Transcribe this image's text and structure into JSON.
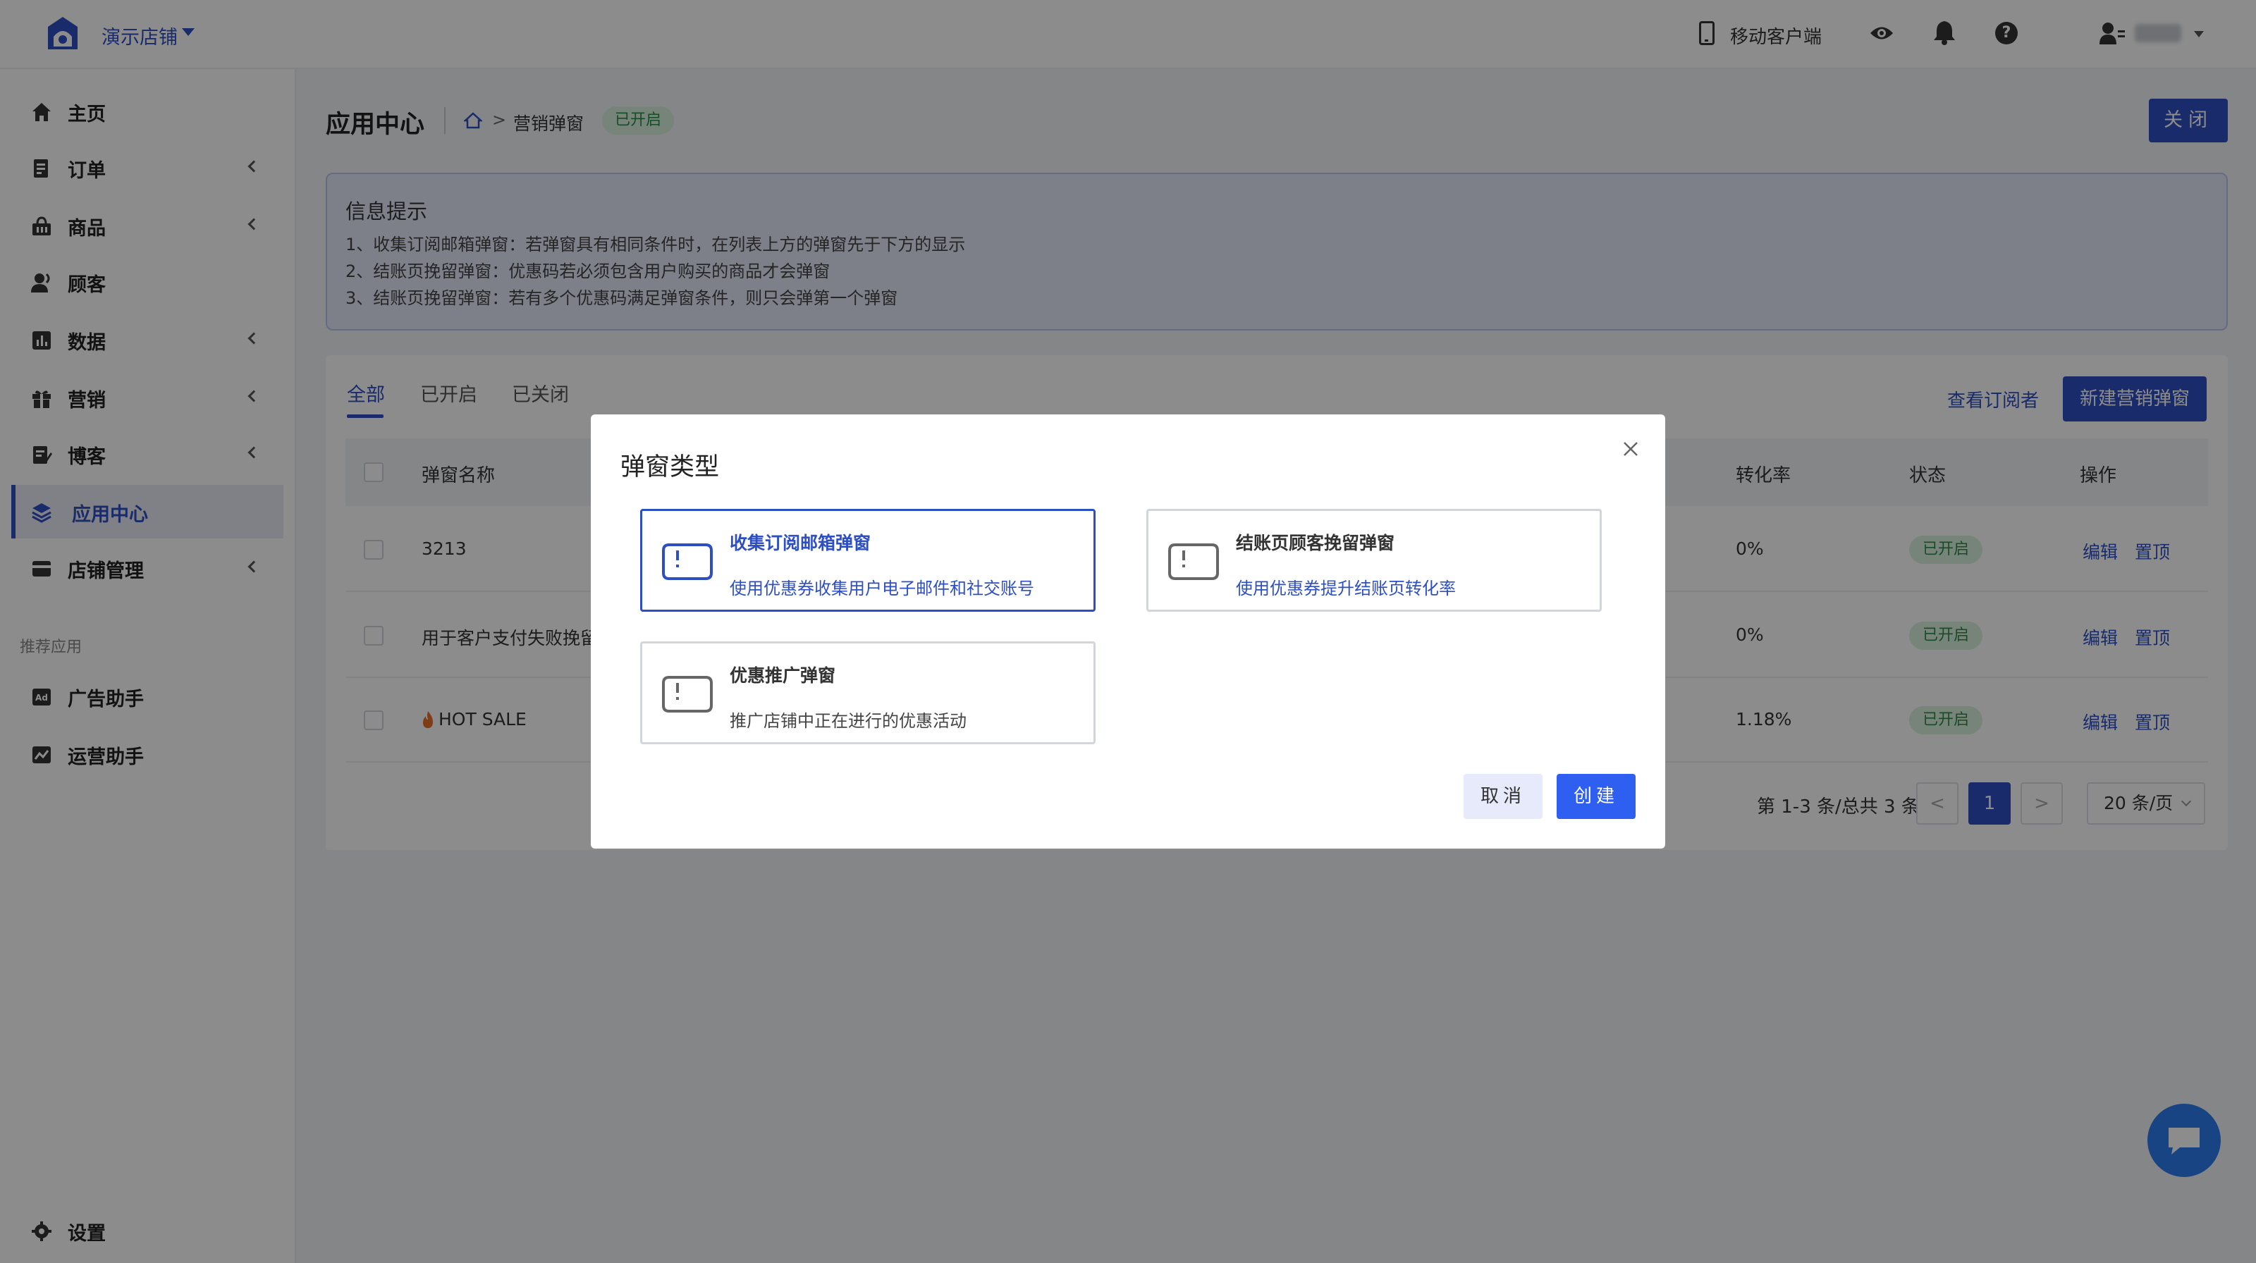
{
  "header": {
    "store_name": "演示店铺",
    "mobile_label": "移动客户端"
  },
  "sidebar": {
    "items": [
      {
        "label": "主页",
        "icon": "home-icon"
      },
      {
        "label": "订单",
        "icon": "order-icon"
      },
      {
        "label": "商品",
        "icon": "basket-icon"
      },
      {
        "label": "顾客",
        "icon": "customer-icon"
      },
      {
        "label": "数据",
        "icon": "chart-icon"
      },
      {
        "label": "营销",
        "icon": "gift-icon"
      },
      {
        "label": "博客",
        "icon": "blog-icon"
      },
      {
        "label": "应用中心",
        "icon": "layers-icon"
      },
      {
        "label": "店铺管理",
        "icon": "store-icon"
      }
    ],
    "section_label": "推荐应用",
    "apps": [
      {
        "label": "广告助手",
        "icon": "ad-icon"
      },
      {
        "label": "运营助手",
        "icon": "ops-icon"
      }
    ],
    "settings_label": "设置"
  },
  "page": {
    "title": "应用中心",
    "breadcrumb_sep": ">",
    "breadcrumb_current": "营销弹窗",
    "breadcrumb_badge": "已开启",
    "close_label": "关闭"
  },
  "info": {
    "title": "信息提示",
    "lines": [
      "1、收集订阅邮箱弹窗：若弹窗具有相同条件时，在列表上方的弹窗先于下方的显示",
      "2、结账页挽留弹窗：优惠码若必须包含用户购买的商品才会弹窗",
      "3、结账页挽留弹窗：若有多个优惠码满足弹窗条件，则只会弹第一个弹窗"
    ]
  },
  "tabs": [
    "全部",
    "已开启",
    "已关闭"
  ],
  "actions": {
    "view_subscribers": "查看订阅者",
    "new_popup": "新建营销弹窗"
  },
  "table": {
    "headers": [
      "弹窗名称",
      "转化率",
      "状态",
      "操作"
    ],
    "rows": [
      {
        "name": "3213",
        "rate": "0%",
        "status": "已开启",
        "edit": "编辑",
        "pin": "置顶"
      },
      {
        "name": "用于客户支付失败挽留",
        "rate": "0%",
        "status": "已开启",
        "edit": "编辑",
        "pin": "置顶"
      },
      {
        "name": "HOT SALE",
        "rate": "1.18%",
        "status": "已开启",
        "edit": "编辑",
        "pin": "置顶"
      }
    ]
  },
  "pagination": {
    "summary": "第 1-3 条/总共 3 条",
    "prev": "<",
    "current": "1",
    "next": ">",
    "page_size": "20 条/页"
  },
  "modal": {
    "title": "弹窗类型",
    "options": [
      {
        "title": "收集订阅邮箱弹窗",
        "desc": "使用优惠券收集用户电子邮件和社交账号",
        "selected": true
      },
      {
        "title": "结账页顾客挽留弹窗",
        "desc": "使用优惠券提升结账页转化率",
        "selected": false
      },
      {
        "title": "优惠推广弹窗",
        "desc": "推广店铺中正在进行的优惠活动",
        "selected": false
      }
    ],
    "cancel_label": "取消",
    "create_label": "创建"
  },
  "colors": {
    "primary": "#2e4fc2",
    "create_button": "#2e5ff0",
    "badge_bg": "#d8f0dd",
    "badge_text": "#2a8c45",
    "chat": "#2e7cf0"
  }
}
